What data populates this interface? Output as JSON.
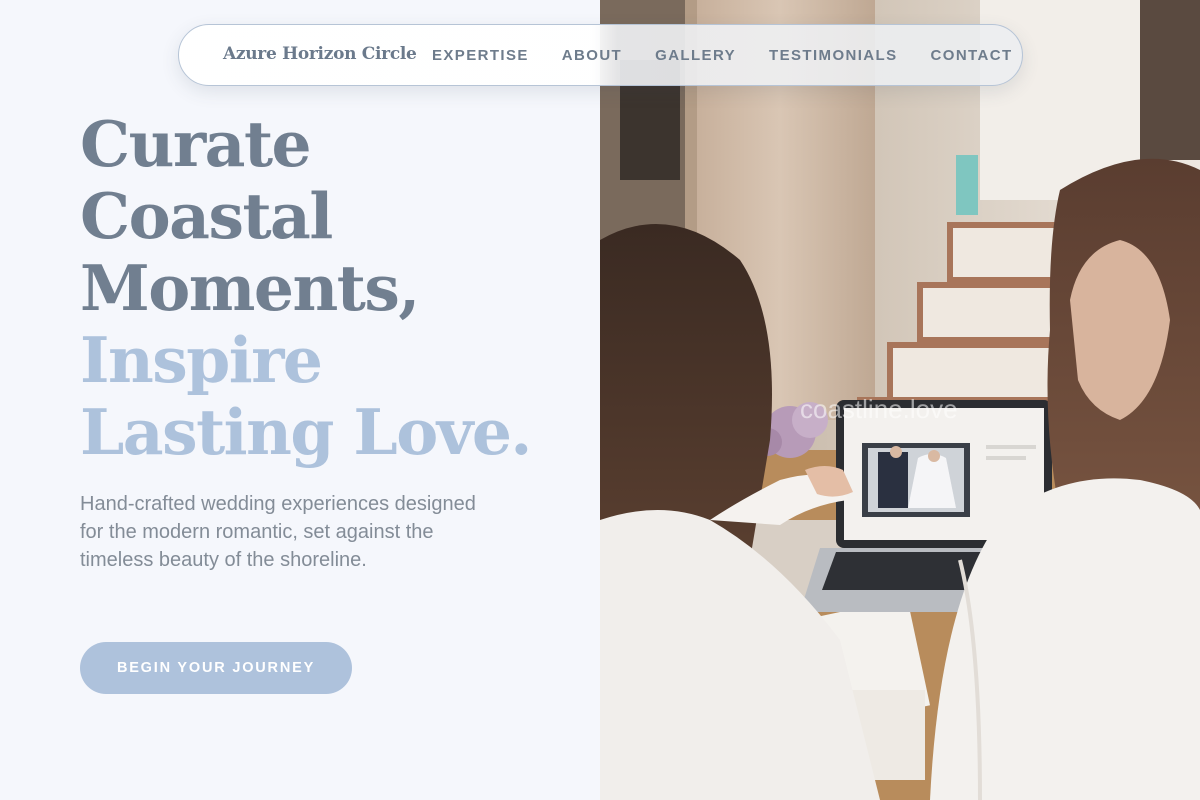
{
  "nav": {
    "brand": "Azure Horizon Circle",
    "links": [
      "EXPERTISE",
      "ABOUT",
      "GALLERY",
      "TESTIMONIALS",
      "CONTACT"
    ]
  },
  "hero": {
    "headline_lines_dark": [
      "Curate",
      "Coastal",
      "Moments,"
    ],
    "headline_lines_light": [
      "Inspire",
      "Lasting Love."
    ],
    "lead": "Hand-crafted wedding experiences designed for the modern romantic, set against the timeless beauty of the shoreline.",
    "cta_label": "BEGIN YOUR JOURNEY"
  },
  "photo": {
    "watermark": "coastline.love",
    "subject": "two-women-viewing-wedding-photo-on-laptop"
  },
  "colors": {
    "background": "#f5f7fc",
    "headline_dark": "#717f90",
    "headline_light": "#adc2dc",
    "body_text": "#838c97",
    "cta_background": "#aec2dc",
    "nav_text": "#6e7c8c"
  }
}
